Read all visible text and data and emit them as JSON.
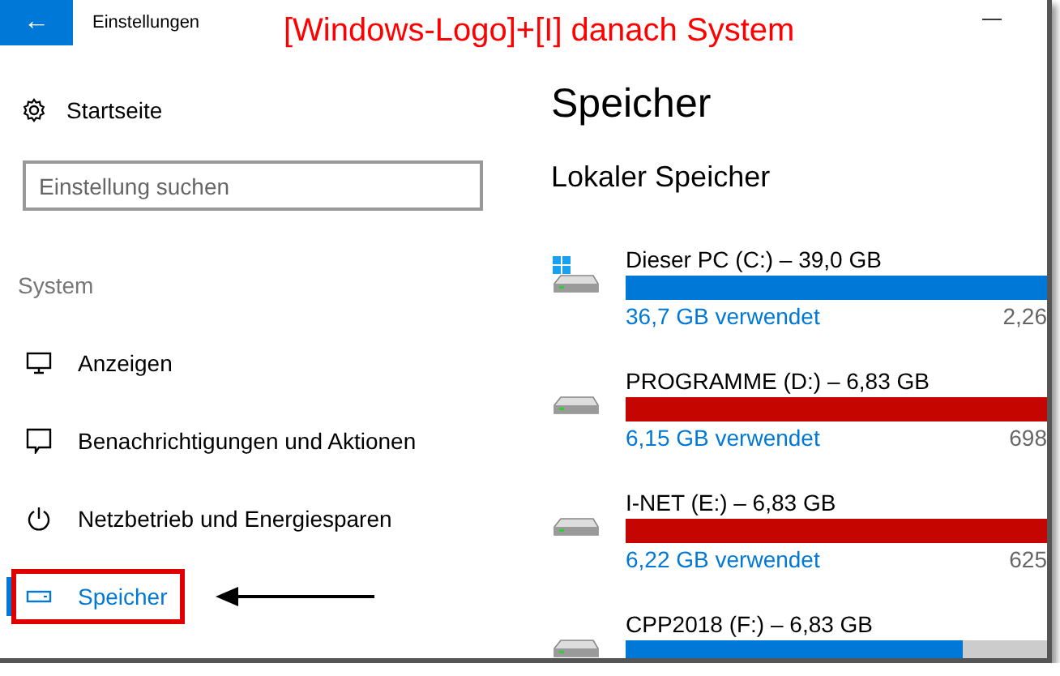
{
  "window": {
    "title": "Einstellungen",
    "back_button": "←",
    "minimize": "—"
  },
  "annotation": {
    "text": "[Windows-Logo]+[I] danach System"
  },
  "sidebar": {
    "home": "Startseite",
    "search": {
      "placeholder": "Einstellung suchen"
    },
    "section": "System",
    "items": [
      {
        "label": "Anzeigen",
        "kind": "monitor",
        "selected": false
      },
      {
        "label": "Benachrichtigungen und Aktionen",
        "kind": "message",
        "selected": false
      },
      {
        "label": "Netzbetrieb und Energiesparen",
        "kind": "power",
        "selected": false
      },
      {
        "label": "Speicher",
        "kind": "storage",
        "selected": true
      }
    ]
  },
  "content": {
    "title": "Speicher",
    "subtitle": "Lokaler Speicher",
    "drives": [
      {
        "name": "Dieser PC (C:) – 39,0 GB",
        "used": "36,7 GB verwendet",
        "free": "2,26",
        "level": 1,
        "color": "#0078d7",
        "system": true
      },
      {
        "name": "PROGRAMME (D:) – 6,83 GB",
        "used": "6,15 GB verwendet",
        "free": "698",
        "level": 1,
        "color": "#c50500",
        "system": false
      },
      {
        "name": "I-NET (E:) – 6,83 GB",
        "used": "6,22 GB verwendet",
        "free": "625",
        "level": 1,
        "color": "#c50500",
        "system": false
      },
      {
        "name": "CPP2018 (F:) – 6,83 GB",
        "level": 0.8,
        "color": "#0078d7",
        "system": false
      }
    ]
  }
}
